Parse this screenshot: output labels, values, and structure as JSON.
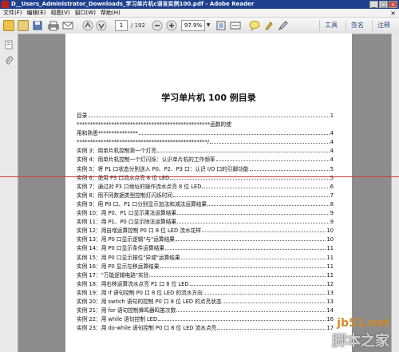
{
  "titlebar": {
    "title": "D__Users_Administrator_Downloads_学习单片机c语言实例100.pdf - Adobe Reader",
    "minimize": "_",
    "maximize": "□",
    "close": "×"
  },
  "menu": {
    "items": [
      "文件(F)",
      "编辑(E)",
      "视图(V)",
      "窗口(W)",
      "帮助(H)"
    ],
    "close_glyph": "×"
  },
  "toolbar": {
    "page_current": "1",
    "page_total": "/ 192",
    "zoom": "97.9%",
    "tools_label": "工具",
    "sign_label": "签名",
    "comment_label": "注释"
  },
  "document": {
    "title": "学习单片机 100 例目录",
    "toc": [
      {
        "text": "目录",
        "page": "1"
      },
      {
        "text": "**************************************************函数的使",
        "page": ""
      },
      {
        "text": "用和熟悉***************",
        "page": "4"
      },
      {
        "text": "*************************************************/",
        "page": "4"
      },
      {
        "text": "实例 3：用单片机控制第一个灯亮",
        "page": "4"
      },
      {
        "text": "实例 4：用单片机控制一个灯闪烁：认识单片机的工作频率",
        "page": "4"
      },
      {
        "text": "实例 5：将 P1 口状态分别送入 P0、P2、P3 口：认识 I/O 口的引脚功能",
        "page": "5"
      },
      {
        "text": "实例 6：使用 P3 口流水点亮 8 位 LED",
        "page": "5"
      },
      {
        "text": "实例 7：通过对 P3 口地址的操作流水点亮 8 位 LED",
        "page": "6"
      },
      {
        "text": "实例 8：用不同数据类型控制灯闪烁时间",
        "page": "7"
      },
      {
        "text": "实例 9：用 P0 口、P1 口分别显示加法和减法运算结果",
        "page": "8"
      },
      {
        "text": "实例 10：用 P0、P1 口显示乘法运算结果",
        "page": "9"
      },
      {
        "text": "实例 11：用 P1、P0 口显示除法运算结果",
        "page": "9"
      },
      {
        "text": "实例 12：用自增运算控制 P0 口 8 位 LED 流水花样",
        "page": "10"
      },
      {
        "text": "实例 13：用 P0 口显示逻辑\"与\"运算结果",
        "page": "10"
      },
      {
        "text": "实例 14：用 P0 口显示条件运算结果",
        "page": "11"
      },
      {
        "text": "实例 15：用 P0 口显示按位\"异或\"运算结果",
        "page": "11"
      },
      {
        "text": "实例 16：用 P0 显示左移运算结果",
        "page": "11"
      },
      {
        "text": "实例 17：\"万能逻辑电路\"实验",
        "page": "11"
      },
      {
        "text": "实例 18：用右移运算流水点亮 P1 口 8 位 LED",
        "page": "12"
      },
      {
        "text": "实例 19：用 if 语句控制 P0 口 8 位 LED 的流水方向",
        "page": "13"
      },
      {
        "text": "实例 20：用 swtich 语句的控制 P0 口 8 位 LED 的点亮状态",
        "page": "13"
      },
      {
        "text": "实例 21：用 for 语句控制蜂鸣器鸣笛次数",
        "page": "14"
      },
      {
        "text": "实例 22：用 while 语句控制 LED",
        "page": "16"
      },
      {
        "text": "实例 23：用 do-while 语句控制 P0 口 8 位 LED 流水点亮",
        "page": "17"
      }
    ]
  },
  "watermark": {
    "site": "jb51.net",
    "name": "脚本之家"
  },
  "colors": {
    "titlebar": "#1d3f8e",
    "red_guide": "#d23a3a",
    "viewer_bg": "#8c8c8c"
  }
}
